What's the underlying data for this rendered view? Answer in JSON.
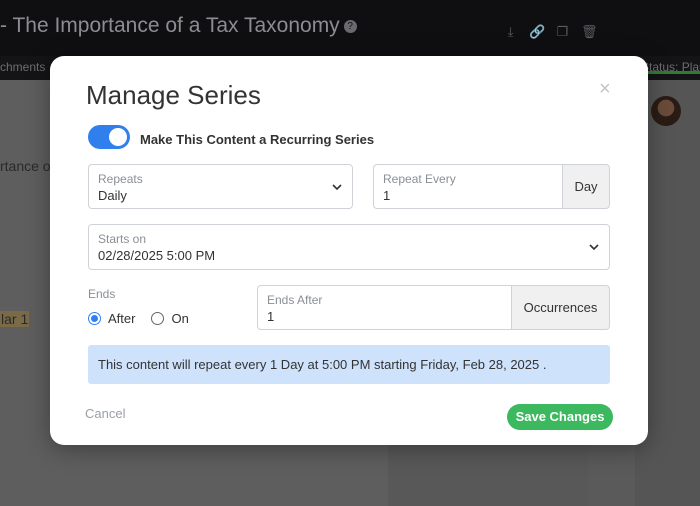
{
  "background": {
    "title": "- The Importance of a Tax Taxonomy",
    "subbar_left": "chments",
    "subbar_right": "Status: Plan",
    "text_line1": "rtance o",
    "text_line2": "lar 1"
  },
  "modal": {
    "title": "Manage Series",
    "toggle_label": "Make This Content a Recurring Series",
    "repeats": {
      "label": "Repeats",
      "value": "Daily"
    },
    "repeat_every": {
      "label": "Repeat Every",
      "value": "1",
      "unit": "Day"
    },
    "starts_on": {
      "label": "Starts on",
      "value": "02/28/2025 5:00 PM"
    },
    "ends": {
      "label": "Ends",
      "option_after": "After",
      "option_on": "On",
      "selected": "After"
    },
    "ends_after": {
      "label": "Ends After",
      "value": "1",
      "unit": "Occurrences"
    },
    "info": "This content will repeat every 1 Day at 5:00 PM starting Friday, Feb 28, 2025 .",
    "cancel_label": "Cancel",
    "save_label": "Save Changes"
  },
  "colors": {
    "accent": "#2f80ed",
    "save": "#3cb85f",
    "info_bg": "#cfe2fb"
  }
}
